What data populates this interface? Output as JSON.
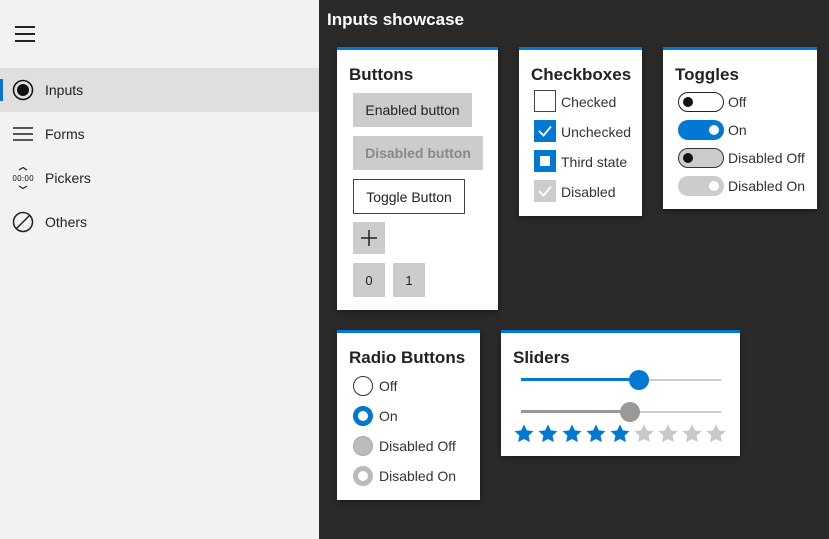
{
  "sidebar": {
    "menu_icon": "hamburger-icon",
    "items": [
      {
        "label": "Inputs",
        "icon": "radio-button-icon",
        "selected": true
      },
      {
        "label": "Forms",
        "icon": "lines-icon"
      },
      {
        "label": "Pickers",
        "icon": "time-picker-icon",
        "icon_text": "00:00"
      },
      {
        "label": "Others",
        "icon": "circle-slash-icon"
      }
    ]
  },
  "main": {
    "title": "Inputs showcase"
  },
  "buttons_card": {
    "title": "Buttons",
    "enabled_label": "Enabled button",
    "disabled_label": "Disabled button",
    "toggle_label": "Toggle Button",
    "add_icon": "plus-icon",
    "zero_label": "0",
    "one_label": "1"
  },
  "checkboxes_card": {
    "title": "Checkboxes",
    "items": [
      {
        "label": "Checked",
        "state": "empty"
      },
      {
        "label": "Unchecked",
        "state": "checked"
      },
      {
        "label": "Third state",
        "state": "indeterminate"
      },
      {
        "label": "Disabled",
        "state": "disabled-checked"
      }
    ]
  },
  "toggles_card": {
    "title": "Toggles",
    "items": [
      {
        "label": "Off",
        "state": "off"
      },
      {
        "label": "On",
        "state": "on"
      },
      {
        "label": "Disabled Off",
        "state": "disabled-off"
      },
      {
        "label": "Disabled On",
        "state": "disabled-on"
      }
    ]
  },
  "radio_card": {
    "title": "Radio Buttons",
    "items": [
      {
        "label": "Off",
        "state": "off"
      },
      {
        "label": "On",
        "state": "on"
      },
      {
        "label": "Disabled Off",
        "state": "disabled-off"
      },
      {
        "label": "Disabled On",
        "state": "disabled-on"
      }
    ]
  },
  "sliders_card": {
    "title": "Sliders",
    "slider1_value": 0.6,
    "slider2_value": 0.55,
    "rating_max": 9,
    "rating_value": 5
  },
  "colors": {
    "accent": "#0078d4",
    "disabled": "#cccccc",
    "star_off": "#c8c8c8"
  }
}
